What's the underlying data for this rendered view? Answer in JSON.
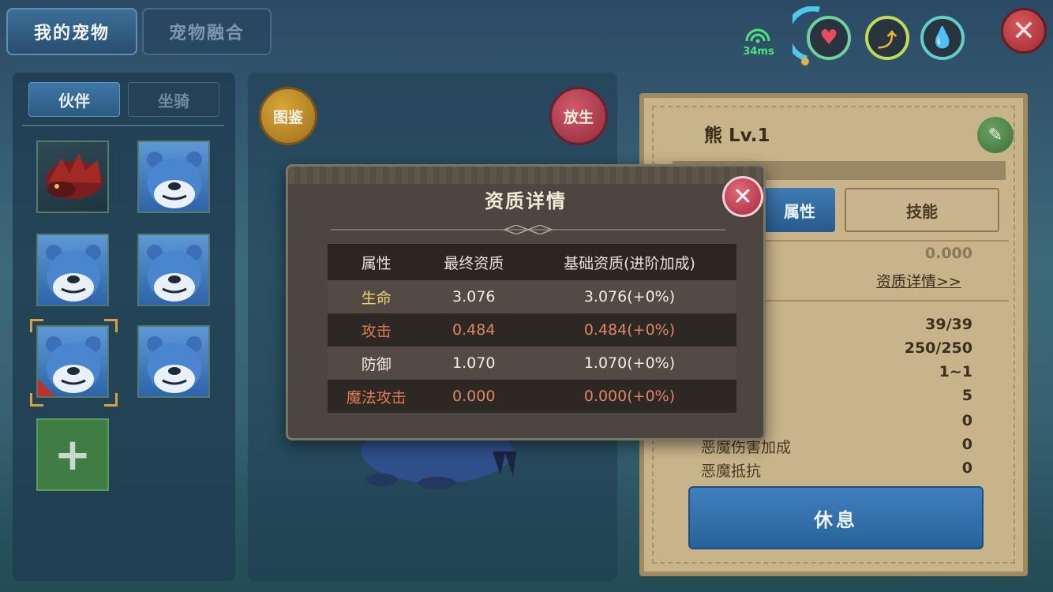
{
  "tabs": {
    "my_pets": "我的宠物",
    "pet_fusion": "宠物融合"
  },
  "hud": {
    "ping": "34ms"
  },
  "left": {
    "sub_tabs": {
      "partner": "伙伴",
      "mount": "坐骑"
    },
    "slots": [
      "red-beast",
      "bear",
      "bear",
      "bear",
      "bear",
      "bear"
    ],
    "add_label": "+"
  },
  "middle": {
    "codex": "图鉴",
    "release": "放生"
  },
  "right": {
    "pet_name": "熊 Lv.1",
    "tabs": {
      "attr": "属性",
      "skill": "技能"
    },
    "top_value": "0.000",
    "detail_link": "资质详情>>",
    "stats": [
      {
        "label": "",
        "value": "39/39"
      },
      {
        "label": "",
        "value": "250/250"
      },
      {
        "label": "",
        "value": "1~1"
      },
      {
        "label": "",
        "value": "5"
      },
      {
        "label": "",
        "value": "0"
      },
      {
        "label": "恶魔伤害加成",
        "value": "0"
      },
      {
        "label": "恶魔抵抗",
        "value": "0"
      }
    ],
    "rest_button": "休息"
  },
  "modal": {
    "title": "资质详情",
    "headers": [
      "属性",
      "最终资质",
      "基础资质(进阶加成)"
    ],
    "rows": [
      {
        "name": "生命",
        "final": "3.076",
        "base": "3.076(+0%)"
      },
      {
        "name": "攻击",
        "final": "0.484",
        "base": "0.484(+0%)"
      },
      {
        "name": "防御",
        "final": "1.070",
        "base": "1.070(+0%)"
      },
      {
        "name": "魔法攻击",
        "final": "0.000",
        "base": "0.000(+0%)"
      }
    ]
  },
  "colors": {
    "accent_blue": "#3b6f96",
    "panel_tan": "#c8b48a",
    "modal_bg": "#4d4640",
    "highlight_red": "#e08468"
  }
}
